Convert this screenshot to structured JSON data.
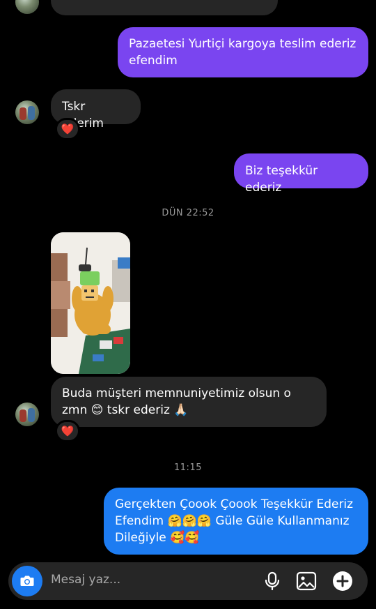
{
  "conversation": {
    "messages": [
      {
        "id": "m1",
        "side": "out",
        "text": "Pazaetesi Yurtiçi kargoya teslim ederiz efendim"
      },
      {
        "id": "m2",
        "side": "in",
        "text": "Tskr ederim",
        "reaction": "❤️"
      },
      {
        "id": "m3",
        "side": "out",
        "text": "Biz teşekkür ederiz"
      },
      {
        "id": "m4",
        "side": "in",
        "type": "image"
      },
      {
        "id": "m5",
        "side": "in",
        "text": "Buda müşteri memnuniyetimiz olsun o zmn 😊 tskr ederiz 🙏🏻",
        "reaction": "❤️"
      },
      {
        "id": "m6",
        "side": "out",
        "text": "Gerçekten Çoook Çoook Teşekkür Ederiz Efendim 🤗🤗🤗 Güle Güle Kullanmanız Dileğiyle 🥰🥰"
      }
    ],
    "timestamps": [
      "DÜN 22:52",
      "11:15"
    ]
  },
  "composer": {
    "placeholder": "Mesaj yaz...",
    "icons": [
      "camera-icon",
      "microphone-icon",
      "gallery-icon",
      "plus-icon"
    ],
    "accent_color": "#1d7cf2"
  },
  "colors": {
    "background": "#000000",
    "incoming_bubble": "#262626",
    "outgoing_purple": "#7a45f0",
    "outgoing_blue": "#1d7cf2"
  }
}
